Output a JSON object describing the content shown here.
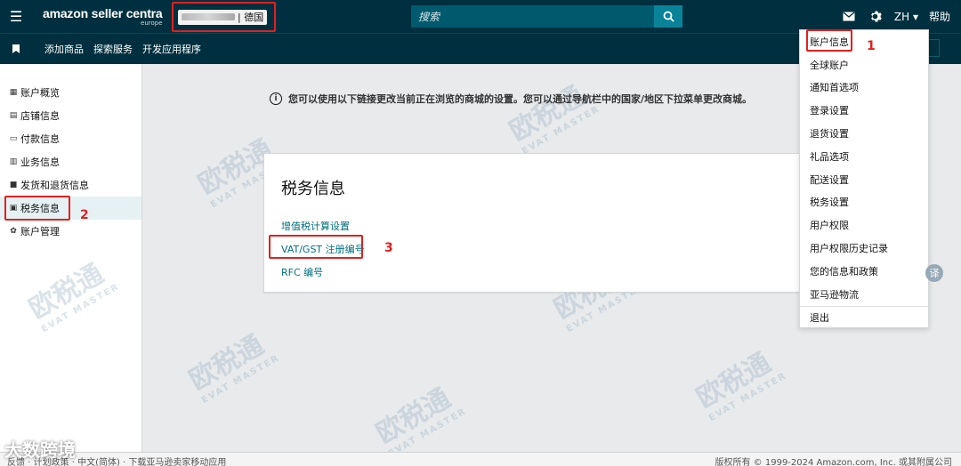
{
  "header": {
    "logo_main": "amazon seller centra",
    "logo_sub": "europe",
    "account_country": "| 德国",
    "search_placeholder": "搜索",
    "lang": "ZH ▾",
    "help": "帮助"
  },
  "nav": {
    "links": [
      "添加商品",
      "探索服务",
      "开发应用程序"
    ]
  },
  "sidebar": {
    "items": [
      {
        "label": "账户概览",
        "icon": "grid-icon"
      },
      {
        "label": "店铺信息",
        "icon": "store-icon"
      },
      {
        "label": "付款信息",
        "icon": "card-icon"
      },
      {
        "label": "业务信息",
        "icon": "building-icon"
      },
      {
        "label": "发货和退货信息",
        "icon": "truck-icon"
      },
      {
        "label": "税务信息",
        "icon": "folder-icon"
      },
      {
        "label": "账户管理",
        "icon": "gear-icon"
      }
    ]
  },
  "main": {
    "notice": "您可以使用以下链接更改当前正在浏览的商城的设置。您可以通过导航栏中的国家/地区下拉菜单更改商城。",
    "card_title": "税务信息",
    "links": [
      "增值税计算设置",
      "VAT/GST 注册编号",
      "RFC 编号"
    ]
  },
  "dropdown": {
    "items": [
      "账户信息",
      "全球账户",
      "通知首选项",
      "登录设置",
      "退货设置",
      "礼品选项",
      "配送设置",
      "税务设置",
      "用户权限",
      "用户权限历史记录",
      "您的信息和政策",
      "亚马逊物流"
    ],
    "logout": "退出"
  },
  "annotations": {
    "n1": "1",
    "n2": "2",
    "n3": "3"
  },
  "footer": {
    "left": "反馈  ·  计划政策  ·  中文(简体)  ·  下载亚马逊卖家移动应用",
    "right": "版权所有 © 1999-2024 Amazon.com, Inc. 或其附属公司"
  },
  "overlay": {
    "translate_badge": "译",
    "watermark_cn": "欧税通",
    "watermark_en": "EVAT MASTER",
    "corner_logo": "大数跨境"
  },
  "colors": {
    "topbar": "#00303f",
    "link": "#00707e",
    "highlight": "#e02020"
  }
}
